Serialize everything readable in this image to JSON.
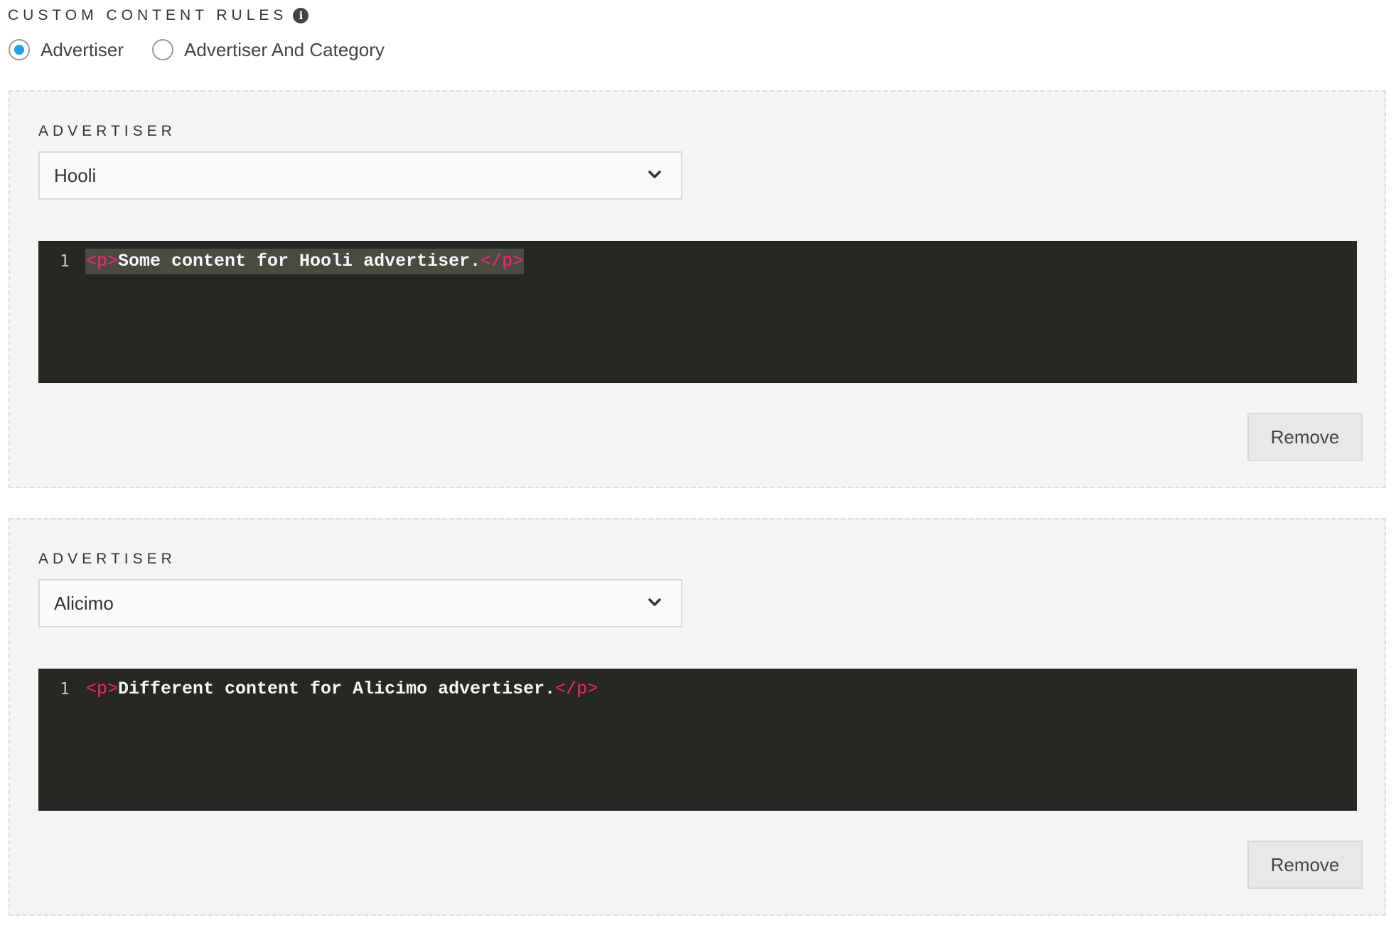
{
  "header": {
    "title": "CUSTOM CONTENT RULES",
    "info_glyph": "i"
  },
  "rule_type": {
    "options": [
      {
        "label": "Advertiser",
        "checked": true
      },
      {
        "label": "Advertiser And Category",
        "checked": false
      }
    ]
  },
  "rules": [
    {
      "field_label": "ADVERTISER",
      "advertiser": "Hooli",
      "editor": {
        "line_number": "1",
        "open_tag": "<p>",
        "text": "Some content for Hooli advertiser.",
        "close_tag": "</p>"
      },
      "remove_label": "Remove"
    },
    {
      "field_label": "ADVERTISER",
      "advertiser": "Alicimo",
      "editor": {
        "line_number": "1",
        "open_tag": "<p>",
        "text": "Different content for Alicimo advertiser.",
        "close_tag": "</p>"
      },
      "remove_label": "Remove"
    }
  ],
  "colors": {
    "accent": "#1aa3e8",
    "editor_background": "#272822",
    "editor_tag": "#f92672",
    "panel_background": "#f4f4f4"
  },
  "icons": {
    "info": "info-icon",
    "dropdown": "chevron-down-icon"
  }
}
